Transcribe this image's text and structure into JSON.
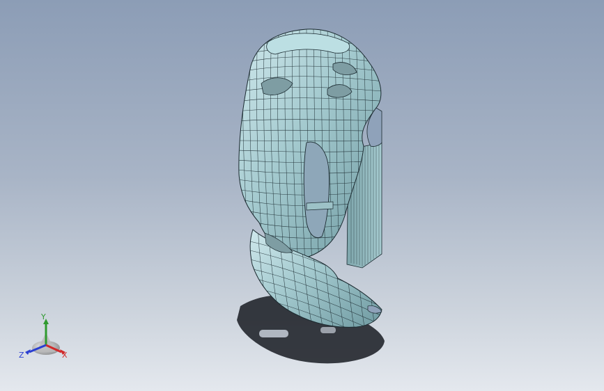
{
  "viewport": {
    "background_top": "#8c9db6",
    "background_bottom": "#e4e8ee"
  },
  "model": {
    "surface_color": "#a9cdd2",
    "mesh_color": "#1b2a30",
    "shadow_color": "#1e2128"
  },
  "triad": {
    "x_label": "X",
    "y_label": "Y",
    "z_label": "Z",
    "x_color": "#d12a2a",
    "y_color": "#2f9a2f",
    "z_color": "#2a3fd1"
  }
}
